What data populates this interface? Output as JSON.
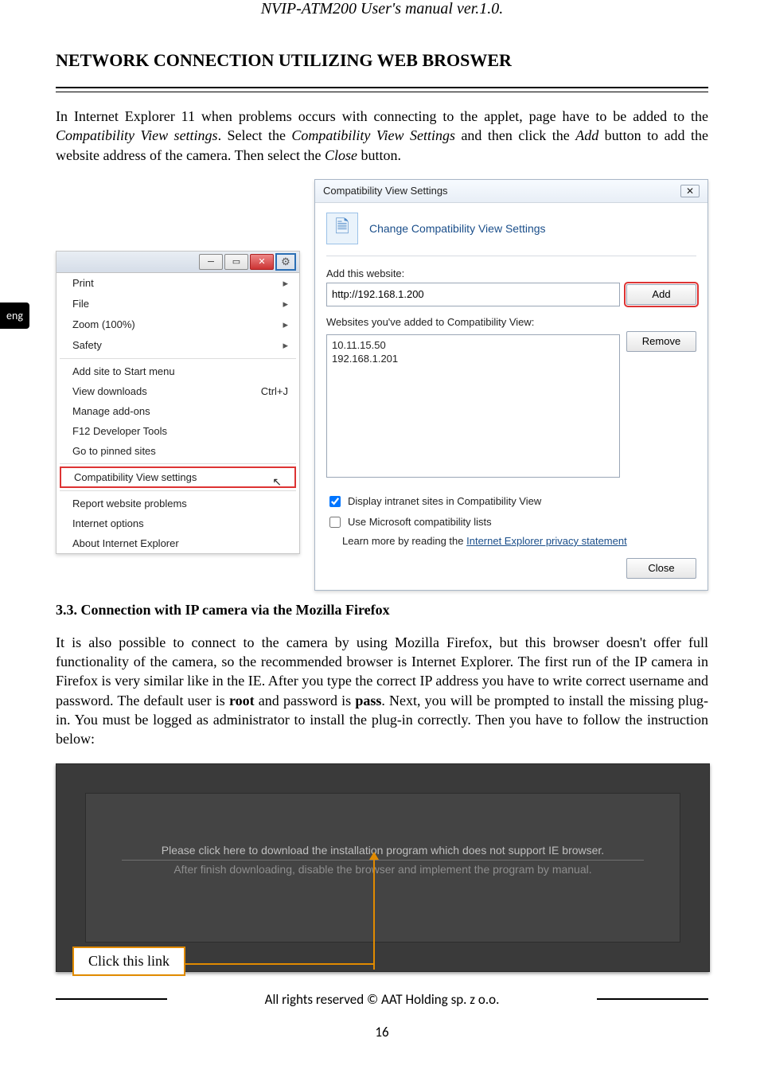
{
  "header": {
    "title": "NVIP-ATM200 User's manual ver.1.0."
  },
  "lang_tab": "eng",
  "section_head": "NETWORK CONNECTION UTILIZING WEB BROSWER",
  "intro": {
    "p1a": "In Internet Explorer 11  when  problems occurs with connecting to the applet, page have to be added to the ",
    "p1b": "Compatibility View settings",
    "p1c": ". Select the ",
    "p1d": "Compatibility View Settings",
    "p1e": " and then click the ",
    "p1f": "Add",
    "p1g": " button to add the website address of the camera. Then select the ",
    "p1h": "Close",
    "p1i": " button."
  },
  "ie_menu": {
    "items_top": [
      "Print",
      "File",
      "Zoom (100%)",
      "Safety"
    ],
    "items_mid": [
      {
        "label": "Add site to Start menu",
        "shortcut": ""
      },
      {
        "label": "View downloads",
        "shortcut": "Ctrl+J"
      },
      {
        "label": "Manage add-ons",
        "shortcut": ""
      },
      {
        "label": "F12 Developer Tools",
        "shortcut": ""
      },
      {
        "label": "Go to pinned sites",
        "shortcut": ""
      }
    ],
    "highlight": "Compatibility View settings",
    "items_bot": [
      "Report website problems",
      "Internet options",
      "About Internet Explorer"
    ]
  },
  "compat": {
    "title": "Compatibility View Settings",
    "banner": "Change Compatibility View Settings",
    "add_label": "Add this website:",
    "add_value": "http://192.168.1.200",
    "add_btn": "Add",
    "list_label": "Websites you've added to Compatibility View:",
    "list_items": [
      "10.11.15.50",
      "192.168.1.201"
    ],
    "remove_btn": "Remove",
    "cbx1": "Display intranet sites in Compatibility View",
    "cbx2": "Use Microsoft compatibility lists",
    "learn_a": "Learn more by reading the ",
    "learn_link": "Internet Explorer privacy statement",
    "close_btn": "Close"
  },
  "subhead": "3.3. Connection with IP camera via the Mozilla Firefox",
  "ff_para": {
    "a": "It is also possible to connect to the camera by using Mozilla Firefox, but this browser doesn't offer full functionality of the camera, so the recommended browser is Internet Explorer. The first run of the IP camera in Firefox is very similar like in the IE. After you type the correct IP address you have to write correct username and password. The default user is ",
    "b": "root",
    "c": " and password is ",
    "d": "pass",
    "e": ". Next, you will be prompted to install the missing plug-in. You must be logged as administrator to install the plug-in correctly. Then you have to follow the instruction below:"
  },
  "ff_mock": {
    "line1": "Please click here to download the installation program which does not support IE browser.",
    "line2": "After finish downloading, disable the browser and implement the program by manual."
  },
  "callout": "Click this link",
  "footer": "All rights reserved © AAT Holding sp. z o.o.",
  "page_num": "16"
}
